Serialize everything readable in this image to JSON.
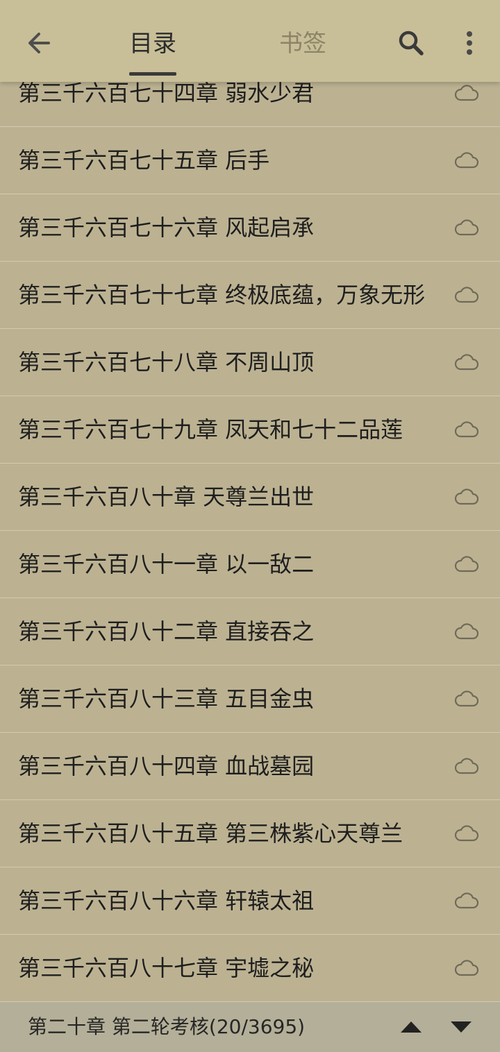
{
  "header": {
    "tabs": [
      {
        "label": "目录",
        "active": true
      },
      {
        "label": "书签",
        "active": false
      }
    ],
    "icons": {
      "back": "arrow-left-icon",
      "search": "search-icon",
      "more": "more-vertical-icon"
    }
  },
  "chapters": [
    {
      "title": "第三千六百七十四章 弱水少君",
      "status_icon": "cloud-icon"
    },
    {
      "title": "第三千六百七十五章 后手",
      "status_icon": "cloud-icon"
    },
    {
      "title": "第三千六百七十六章 风起启承",
      "status_icon": "cloud-icon"
    },
    {
      "title": "第三千六百七十七章 终极底蕴，万象无形",
      "status_icon": "cloud-icon"
    },
    {
      "title": "第三千六百七十八章 不周山顶",
      "status_icon": "cloud-icon"
    },
    {
      "title": "第三千六百七十九章 凤天和七十二品莲",
      "status_icon": "cloud-icon"
    },
    {
      "title": "第三千六百八十章 天尊兰出世",
      "status_icon": "cloud-icon"
    },
    {
      "title": "第三千六百八十一章 以一敌二",
      "status_icon": "cloud-icon"
    },
    {
      "title": "第三千六百八十二章 直接吞之",
      "status_icon": "cloud-icon"
    },
    {
      "title": "第三千六百八十三章 五目金虫",
      "status_icon": "cloud-icon"
    },
    {
      "title": "第三千六百八十四章 血战墓园",
      "status_icon": "cloud-icon"
    },
    {
      "title": "第三千六百八十五章 第三株紫心天尊兰",
      "status_icon": "cloud-icon"
    },
    {
      "title": "第三千六百八十六章 轩辕太祖",
      "status_icon": "cloud-icon"
    },
    {
      "title": "第三千六百八十七章 宇墟之秘",
      "status_icon": "cloud-icon"
    }
  ],
  "footer": {
    "current_chapter": "第二十章 第二轮考核(20/3695)",
    "icons": {
      "up": "triangle-up-icon",
      "down": "triangle-down-icon"
    }
  },
  "colors": {
    "header_bg": "#c8bf98",
    "list_bg": "#bcb292",
    "footer_bg": "#b4af98",
    "divider": "#d3cbae",
    "text": "#1e1e1e",
    "inactive_tab": "#8c8468"
  }
}
